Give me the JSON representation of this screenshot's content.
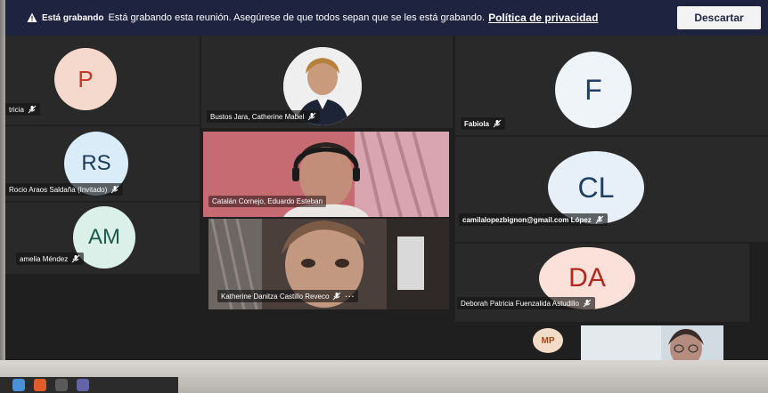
{
  "banner": {
    "recording_label": "Está grabando",
    "message": "Está grabando esta reunión. Asegúrese de que todos sepan que se les está grabando.",
    "privacy_link": "Política de privacidad",
    "dismiss_button": "Descartar",
    "icon": "warning-icon"
  },
  "participants": [
    {
      "id": "p1",
      "initials": "P",
      "name": "tricia",
      "avatar_bg": "#f5d9cc",
      "initials_color": "#c0392b"
    },
    {
      "id": "p2",
      "name": "Bustos Jara, Catherine Mabel"
    },
    {
      "id": "p3",
      "initials": "F",
      "name": "Fabiola",
      "avatar_bg": "#eef4f8",
      "initials_color": "#1f3f63"
    },
    {
      "id": "p4",
      "initials": "RS",
      "name": "Rocio Araos Saldaña (Invitado)",
      "avatar_bg": "#d9ecf7",
      "initials_color": "#1c3a59"
    },
    {
      "id": "p5",
      "name": "Catalán Cornejo, Eduardo Esteban"
    },
    {
      "id": "p6",
      "initials": "CL",
      "name": "camilalopezbignon@gmail.com López",
      "avatar_bg": "#e7f0f8",
      "initials_color": "#1f3f63"
    },
    {
      "id": "p7",
      "initials": "AM",
      "name": "amelia Méndez",
      "avatar_bg": "#daf0e8",
      "initials_color": "#1d5a4c"
    },
    {
      "id": "p8",
      "name": "Katherine Danitza Castillo Reveco",
      "more": "···"
    },
    {
      "id": "p9",
      "initials": "DA",
      "name": "Deborah Patricia Fuenzalida Astudillo",
      "avatar_bg": "#fbe1d9",
      "initials_color": "#b2281d"
    },
    {
      "id": "p10",
      "initials": "MP",
      "avatar_bg": "#f2dcc7",
      "initials_color": "#a14a1d"
    }
  ],
  "icons": {
    "mic_muted": "mic-muted-icon"
  }
}
